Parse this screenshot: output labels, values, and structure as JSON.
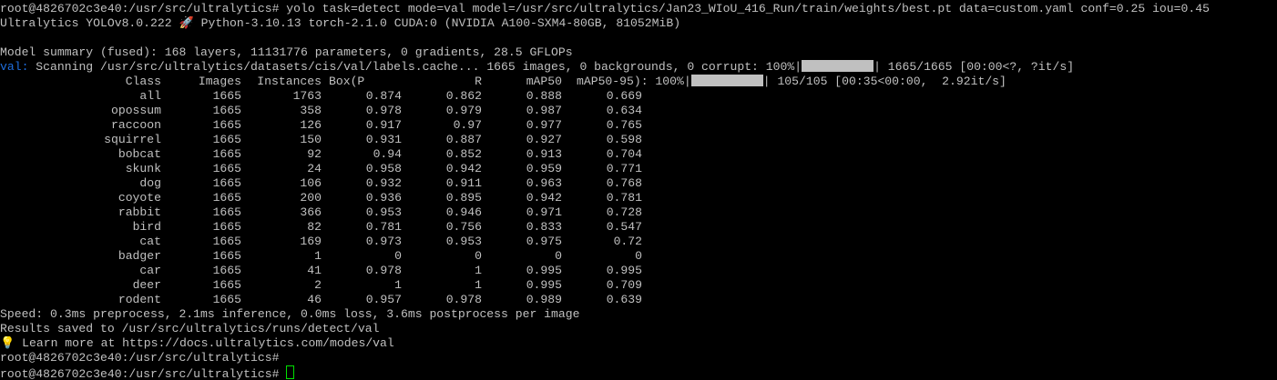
{
  "terminal": {
    "prompt": "root@4826702c3e40:/usr/src/ultralytics#",
    "command": " yolo task=detect mode=val model=/usr/src/ultralytics/Jan23_WIoU_416_Run/train/weights/best.pt data=custom.yaml conf=0.25 iou=0.45",
    "version_line": "Ultralytics YOLOv8.0.222 🚀 Python-3.10.13 torch-2.1.0 CUDA:0 (NVIDIA A100-SXM4-80GB, 81052MiB)",
    "model_summary": "Model summary (fused): 168 layers, 11131776 parameters, 0 gradients, 28.5 GFLOPs",
    "val_label": "val:",
    "scan_text": " Scanning /usr/src/ultralytics/datasets/cis/val/labels.cache... 1665 images, 0 backgrounds, 0 corrupt: 100%|",
    "scan_tail": "| 1665/1665 [00:00<?, ?it/s]",
    "progress_tail": "| 105/105 [00:35<00:00,  2.92it/s]",
    "headers": {
      "class": "Class",
      "images": "Images",
      "instances": "Instances",
      "box_p": "Box(P",
      "r": "R",
      "map50": "mAP50",
      "map50_95": "mAP50-95): 100%|"
    },
    "rows": [
      [
        "all",
        "1665",
        "1763",
        "0.874",
        "0.862",
        "0.888",
        "0.669"
      ],
      [
        "opossum",
        "1665",
        "358",
        "0.978",
        "0.979",
        "0.987",
        "0.634"
      ],
      [
        "raccoon",
        "1665",
        "126",
        "0.917",
        "0.97",
        "0.977",
        "0.765"
      ],
      [
        "squirrel",
        "1665",
        "150",
        "0.931",
        "0.887",
        "0.927",
        "0.598"
      ],
      [
        "bobcat",
        "1665",
        "92",
        "0.94",
        "0.852",
        "0.913",
        "0.704"
      ],
      [
        "skunk",
        "1665",
        "24",
        "0.958",
        "0.942",
        "0.959",
        "0.771"
      ],
      [
        "dog",
        "1665",
        "106",
        "0.932",
        "0.911",
        "0.963",
        "0.768"
      ],
      [
        "coyote",
        "1665",
        "200",
        "0.936",
        "0.895",
        "0.942",
        "0.781"
      ],
      [
        "rabbit",
        "1665",
        "366",
        "0.953",
        "0.946",
        "0.971",
        "0.728"
      ],
      [
        "bird",
        "1665",
        "82",
        "0.781",
        "0.756",
        "0.833",
        "0.547"
      ],
      [
        "cat",
        "1665",
        "169",
        "0.973",
        "0.953",
        "0.975",
        "0.72"
      ],
      [
        "badger",
        "1665",
        "1",
        "0",
        "0",
        "0",
        "0"
      ],
      [
        "car",
        "1665",
        "41",
        "0.978",
        "1",
        "0.995",
        "0.995"
      ],
      [
        "deer",
        "1665",
        "2",
        "1",
        "1",
        "0.995",
        "0.709"
      ],
      [
        "rodent",
        "1665",
        "46",
        "0.957",
        "0.978",
        "0.989",
        "0.639"
      ]
    ],
    "speed_line": "Speed: 0.3ms preprocess, 2.1ms inference, 0.0ms loss, 3.6ms postprocess per image",
    "results_line": "Results saved to /usr/src/ultralytics/runs/detect/val",
    "learn_more": "💡 Learn more at https://docs.ultralytics.com/modes/val",
    "colors": {
      "background": "#000000",
      "text": "#c0c0c0",
      "val_label": "#1f6fe0",
      "cursor": "#00e000"
    }
  }
}
